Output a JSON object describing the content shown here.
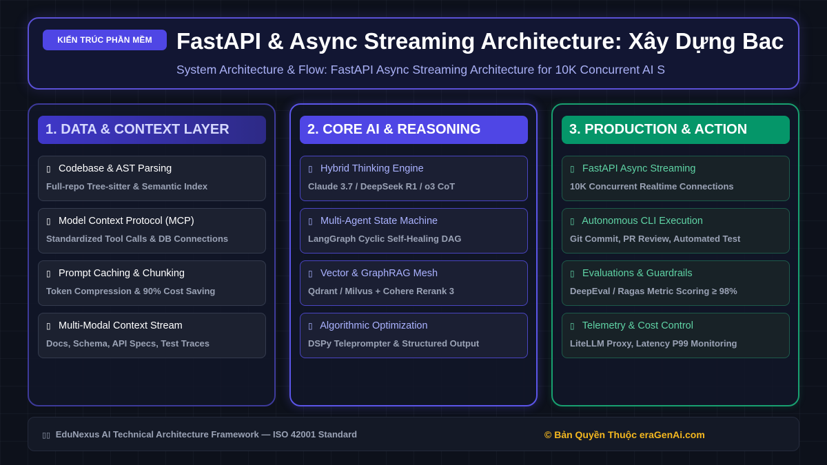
{
  "header": {
    "badge": "KIẾN TRÚC PHẦN MỀM",
    "title": "FastAPI & Async Streaming Architecture: Xây Dựng Bac",
    "subtitle": "System Architecture & Flow: FastAPI Async Streaming Architecture for 10K Concurrent AI S"
  },
  "icon_glyph": "▯",
  "columns": [
    {
      "title": "1. DATA & CONTEXT LAYER",
      "accent": "#3f37c9",
      "cards": [
        {
          "icon": "missing-glyph-icon",
          "title": "Codebase & AST Parsing",
          "desc": "Full-repo Tree-sitter & Semantic Index"
        },
        {
          "icon": "missing-glyph-icon",
          "title": "Model Context Protocol (MCP)",
          "desc": "Standardized Tool Calls & DB Connections"
        },
        {
          "icon": "missing-glyph-icon",
          "title": "Prompt Caching & Chunking",
          "desc": "Token Compression & 90% Cost Saving"
        },
        {
          "icon": "missing-glyph-icon",
          "title": "Multi-Modal Context Stream",
          "desc": "Docs, Schema, API Specs, Test Traces"
        }
      ]
    },
    {
      "title": "2. CORE AI & REASONING",
      "accent": "#4f46e5",
      "cards": [
        {
          "icon": "missing-glyph-icon",
          "title": "Hybrid Thinking Engine",
          "desc": "Claude 3.7 / DeepSeek R1 / o3 CoT"
        },
        {
          "icon": "missing-glyph-icon",
          "title": "Multi-Agent State Machine",
          "desc": "LangGraph Cyclic Self-Healing DAG"
        },
        {
          "icon": "missing-glyph-icon",
          "title": "Vector & GraphRAG Mesh",
          "desc": "Qdrant / Milvus + Cohere Rerank 3"
        },
        {
          "icon": "missing-glyph-icon",
          "title": "Algorithmic Optimization",
          "desc": "DSPy Teleprompter & Structured Output"
        }
      ]
    },
    {
      "title": "3. PRODUCTION & ACTION",
      "accent": "#059669",
      "cards": [
        {
          "icon": "missing-glyph-icon",
          "title": "FastAPI Async Streaming",
          "desc": "10K Concurrent Realtime Connections"
        },
        {
          "icon": "missing-glyph-icon",
          "title": "Autonomous CLI Execution",
          "desc": "Git Commit, PR Review, Automated Test"
        },
        {
          "icon": "missing-glyph-icon",
          "title": "Evaluations & Guardrails",
          "desc": "DeepEval / Ragas Metric Scoring ≥ 98%"
        },
        {
          "icon": "missing-glyph-icon",
          "title": "Telemetry & Cost Control",
          "desc": "LiteLLM Proxy, Latency P99 Monitoring"
        }
      ]
    }
  ],
  "footer": {
    "left_icon": "▯▯",
    "left": "EduNexus AI Technical Architecture Framework — ISO 42001 Standard",
    "right": "© Bản Quyền Thuộc eraGenAi.com"
  }
}
